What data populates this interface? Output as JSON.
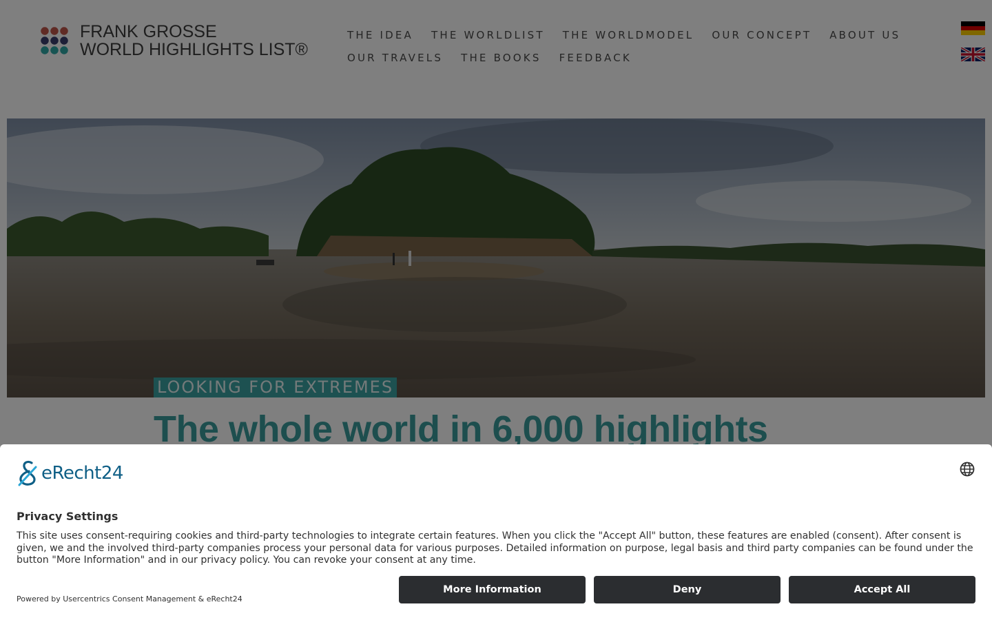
{
  "logo": {
    "line1": "FRANK GROSSE",
    "line2": "WORLD HIGHLIGHTS LIST®",
    "dot_colors": [
      "#c0574a",
      "#c0574a",
      "#c0574a",
      "#3b3f6e",
      "#3b3f6e",
      "#3b3f6e",
      "#2fa9a6",
      "#2fa9a6",
      "#2fa9a6"
    ]
  },
  "nav": {
    "row1": [
      "THE IDEA",
      "THE WORLDLIST",
      "THE WORLDMODEL",
      "OUR CONCEPT",
      "ABOUT US"
    ],
    "row2": [
      "OUR TRAVELS",
      "THE BOOKS",
      "FEEDBACK"
    ]
  },
  "flags": {
    "german": "german-flag-icon",
    "uk": "uk-flag-icon"
  },
  "hero": {
    "kicker": "LOOKING FOR EXTREMES",
    "headline": "The whole world in 6,000 highlights",
    "accent_color": "#3aa3a3"
  },
  "consent": {
    "brand": "eRecht24",
    "title": "Privacy Settings",
    "body": "This site uses consent-requiring cookies and third-party technologies to integrate certain features. When you click the \"Accept All\" button, these features are enabled (consent). After consent is given, we and the involved third-party companies process your personal data for various purposes. Detailed information on purpose, legal basis and third party companies can be found under the button \"More Information\" and in our privacy policy. You can revoke your consent at any time.",
    "powered": "Powered by Usercentrics Consent Management & eRecht24",
    "buttons": {
      "more_info": "More Information",
      "deny": "Deny",
      "accept_all": "Accept All"
    },
    "button_color": "#2b2d30"
  }
}
